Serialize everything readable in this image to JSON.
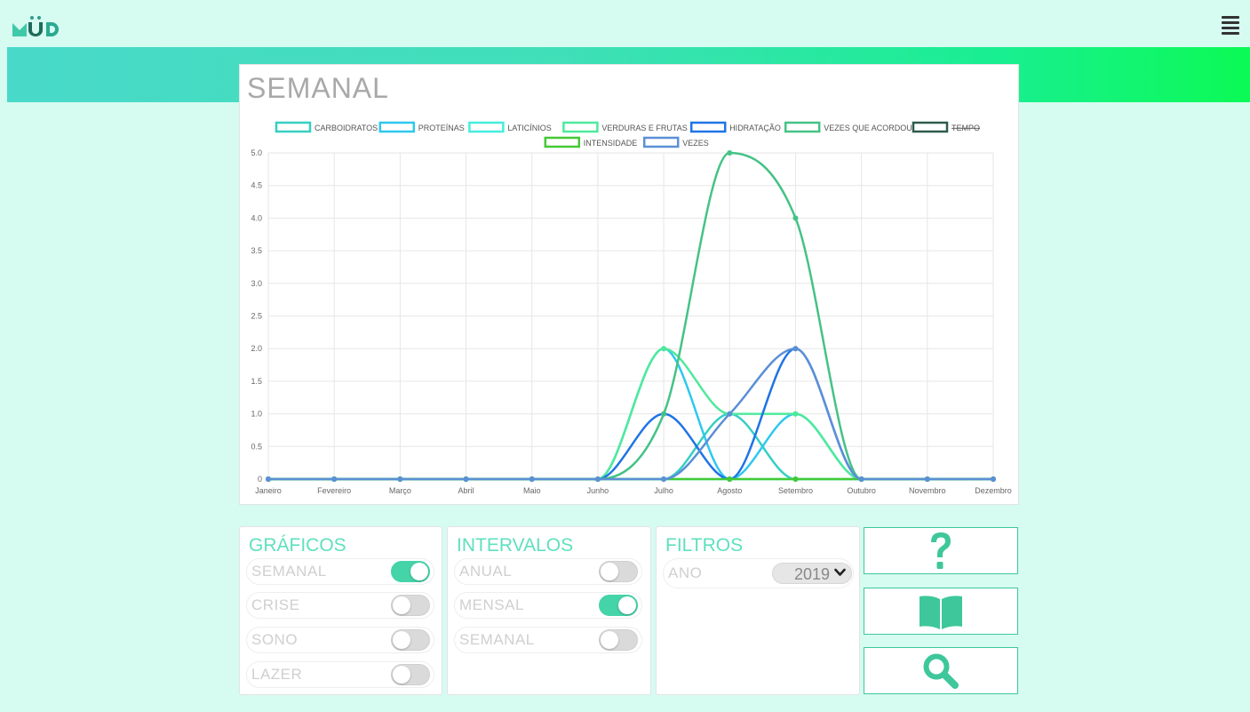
{
  "app": {
    "logo_alt": "MÜD",
    "menu_icon": "hamburger-menu-icon"
  },
  "chart_card": {
    "title": "SEMANAL"
  },
  "chart_data": {
    "type": "line",
    "categories": [
      "Janeiro",
      "Fevereiro",
      "Março",
      "Abril",
      "Maio",
      "Junho",
      "Julho",
      "Agosto",
      "Setembro",
      "Outubro",
      "Novembro",
      "Dezembro"
    ],
    "ylim": [
      0,
      5
    ],
    "yticks": [
      "0",
      "0.5",
      "1.0",
      "1.5",
      "2.0",
      "2.5",
      "3.0",
      "3.5",
      "4.0",
      "4.5",
      "5.0"
    ],
    "grid": true,
    "legend_placement": "top",
    "series": [
      {
        "name": "CARBOIDRATOS",
        "color": "#36cfc3",
        "values": [
          0,
          0,
          0,
          0,
          0,
          0,
          0,
          1,
          0,
          0,
          0,
          0
        ]
      },
      {
        "name": "PROTEÍNAS",
        "color": "#2ec8ee",
        "values": [
          0,
          0,
          0,
          0,
          0,
          0,
          2,
          0,
          1,
          0,
          0,
          0
        ]
      },
      {
        "name": "LATICÍNIOS",
        "color": "#46eddc",
        "values": [
          0,
          0,
          0,
          0,
          0,
          0,
          0,
          0,
          0,
          0,
          0,
          0
        ]
      },
      {
        "name": "VERDURAS E FRUTAS",
        "color": "#4fe99c",
        "values": [
          0,
          0,
          0,
          0,
          0,
          0,
          2,
          1,
          1,
          0,
          0,
          0
        ]
      },
      {
        "name": "HIDRATAÇÃO",
        "color": "#1f74e6",
        "values": [
          0,
          0,
          0,
          0,
          0,
          0,
          1,
          0,
          2,
          0,
          0,
          0
        ]
      },
      {
        "name": "VEZES QUE ACORDOU",
        "color": "#45c286",
        "values": [
          0,
          0,
          0,
          0,
          0,
          0,
          1,
          5,
          4,
          0,
          0,
          0
        ]
      },
      {
        "name": "TEMPO",
        "color": "#2c5b4c",
        "values": [
          0,
          0,
          0,
          0,
          0,
          0,
          0,
          0,
          0,
          0,
          0,
          0
        ],
        "hidden": true
      },
      {
        "name": "INTENSIDADE",
        "color": "#44c935",
        "values": [
          0,
          0,
          0,
          0,
          0,
          0,
          0,
          0,
          0,
          0,
          0,
          0
        ]
      },
      {
        "name": "VEZES",
        "color": "#5b8fd6",
        "values": [
          0,
          0,
          0,
          0,
          0,
          0,
          0,
          1,
          2,
          0,
          0,
          0
        ]
      }
    ]
  },
  "graficos": {
    "title": "GRÁFICOS",
    "options": [
      {
        "label": "SEMANAL",
        "on": true
      },
      {
        "label": "CRISE",
        "on": false
      },
      {
        "label": "SONO",
        "on": false
      },
      {
        "label": "LAZER",
        "on": false
      }
    ]
  },
  "intervalos": {
    "title": "INTERVALOS",
    "options": [
      {
        "label": "ANUAL",
        "on": false
      },
      {
        "label": "MENSAL",
        "on": true
      },
      {
        "label": "SEMANAL",
        "on": false
      }
    ]
  },
  "filtros": {
    "title": "FILTROS",
    "ano_label": "ANO",
    "ano_value": "2019"
  },
  "actions": {
    "help_icon": "question-mark-icon",
    "book_icon": "open-book-icon",
    "search_icon": "magnifier-icon",
    "accent_color": "#3ec79b"
  }
}
